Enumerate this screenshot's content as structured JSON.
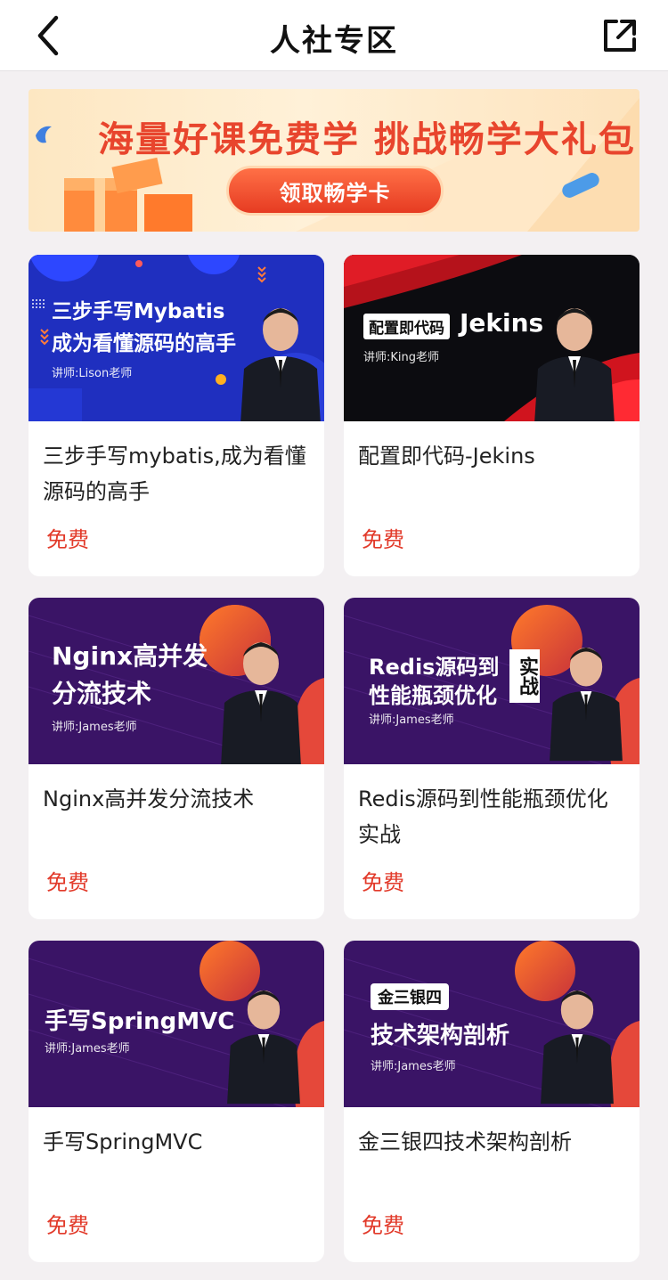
{
  "header": {
    "title": "人社专区",
    "back_icon": "chevron-left-icon",
    "share_icon": "share-external-icon"
  },
  "banner": {
    "headline": "海量好课免费学 挑战畅学大礼包",
    "cta_label": "领取畅学卡"
  },
  "courses": [
    {
      "thumb_line1": "三步手写Mybatis",
      "thumb_line2": "成为看懂源码的高手",
      "thumb_teacher": "讲师:Lison老师",
      "title": "三步手写mybatis,成为看懂源码的高手",
      "price": "免费"
    },
    {
      "thumb_tag": "配置即代码",
      "thumb_line1": "Jekins",
      "thumb_teacher": "讲师:King老师",
      "title": "配置即代码-Jekins",
      "price": "免费"
    },
    {
      "thumb_line1": "Nginx高并发",
      "thumb_line2": "分流技术",
      "thumb_teacher": "讲师:James老师",
      "title": "Nginx高并发分流技术",
      "price": "免费"
    },
    {
      "thumb_line1": "Redis源码到",
      "thumb_line2": "性能瓶颈优化",
      "thumb_box": "实战",
      "thumb_teacher": "讲师:James老师",
      "title": "Redis源码到性能瓶颈优化实战",
      "price": "免费"
    },
    {
      "thumb_line1": "手写SpringMVC",
      "thumb_teacher": "讲师:James老师",
      "title": "手写SpringMVC",
      "price": "免费"
    },
    {
      "thumb_tag": "金三银四",
      "thumb_line1": "技术架构剖析",
      "thumb_teacher": "讲师:James老师",
      "title": "金三银四技术架构剖析",
      "price": "免费"
    }
  ]
}
